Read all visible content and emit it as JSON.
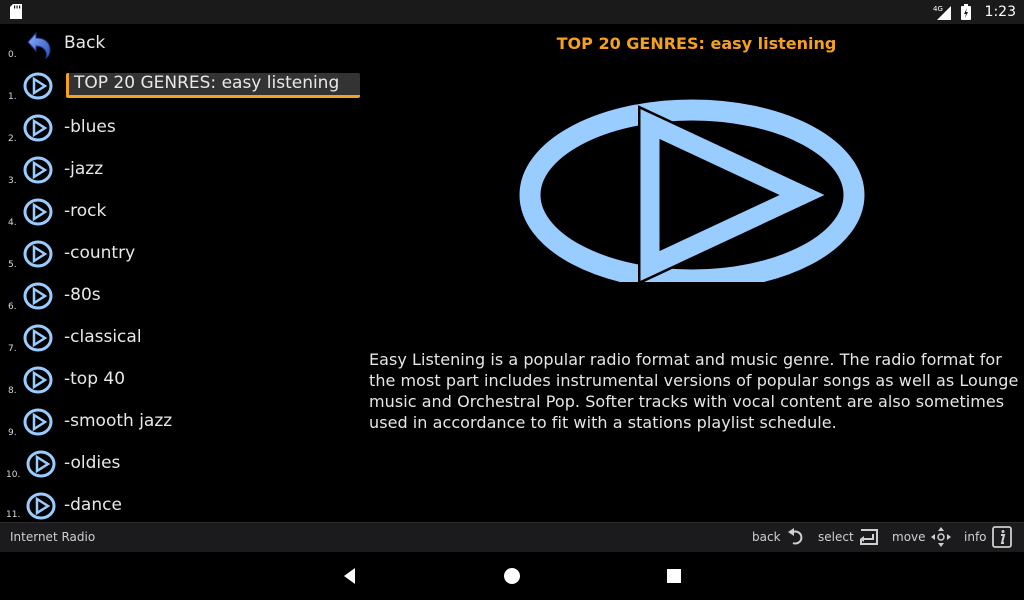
{
  "status_bar": {
    "time": "1:23",
    "network_label": "4G",
    "icons": [
      "sd-card-icon",
      "signal-icon",
      "battery-icon"
    ]
  },
  "list": {
    "items": [
      {
        "num": "0.",
        "label": "Back",
        "icon": "back-arrow-icon"
      },
      {
        "num": "1.",
        "label": "TOP 20 GENRES: easy listening",
        "icon": "play-icon",
        "selected": true
      },
      {
        "num": "2.",
        "label": "-blues",
        "icon": "play-icon"
      },
      {
        "num": "3.",
        "label": "-jazz",
        "icon": "play-icon"
      },
      {
        "num": "4.",
        "label": "-rock",
        "icon": "play-icon"
      },
      {
        "num": "5.",
        "label": "-country",
        "icon": "play-icon"
      },
      {
        "num": "6.",
        "label": "-80s",
        "icon": "play-icon"
      },
      {
        "num": "7.",
        "label": "-classical",
        "icon": "play-icon"
      },
      {
        "num": "8.",
        "label": "-top 40",
        "icon": "play-icon"
      },
      {
        "num": "9.",
        "label": "-smooth jazz",
        "icon": "play-icon"
      },
      {
        "num": "10.",
        "label": "-oldies",
        "icon": "play-icon"
      },
      {
        "num": "11.",
        "label": "-dance",
        "icon": "play-icon"
      }
    ]
  },
  "detail": {
    "title": "TOP 20 GENRES: easy listening",
    "description": "Easy Listening is a popular radio format and music genre. The radio format for the most part includes instrumental versions of popular songs as well as Lounge music and Orchestral Pop. Softer tracks with vocal content are also sometimes used in accordance to fit with a stations playlist schedule.",
    "icon": "large-play-icon"
  },
  "bottom_bar": {
    "app_name": "Internet Radio",
    "hints": [
      {
        "label": "back",
        "icon": "back-icon"
      },
      {
        "label": "select",
        "icon": "select-icon"
      },
      {
        "label": "move",
        "icon": "move-icon"
      },
      {
        "label": "info",
        "icon": "info-icon"
      }
    ]
  },
  "colors": {
    "accent": "#f5a020",
    "play_icon": "#99ccff",
    "background": "#000000"
  }
}
